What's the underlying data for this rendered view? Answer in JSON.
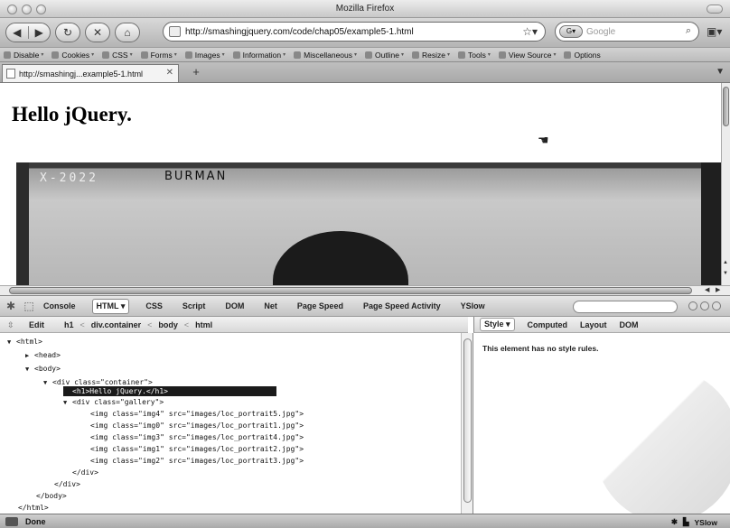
{
  "window": {
    "title": "Mozilla Firefox"
  },
  "nav": {
    "url": "http://smashingjquery.com/code/chap05/example5-1.html",
    "search_placeholder": "Google",
    "back_icon": "back-arrow-icon",
    "forward_icon": "forward-arrow-icon"
  },
  "toolbar": {
    "items": [
      "Disable",
      "Cookies",
      "CSS",
      "Forms",
      "Images",
      "Information",
      "Miscellaneous",
      "Outline",
      "Resize",
      "Tools",
      "View Source",
      "Options"
    ]
  },
  "tab": {
    "label": "http://smashingj...example5-1.html",
    "new_tab": "+"
  },
  "page": {
    "heading": "Hello jQuery.",
    "photo_caption": "X-2022",
    "photo_name": "BURMAN"
  },
  "firebug": {
    "tabs": [
      "Console",
      "HTML ▾",
      "CSS",
      "Script",
      "DOM",
      "Net",
      "Page Speed",
      "Page Speed Activity",
      "YSlow"
    ],
    "breadcrumb": {
      "edit": "Edit",
      "items": [
        "h1",
        "div.container",
        "body",
        "html"
      ]
    },
    "side_tabs": [
      "Style ▾",
      "Computed",
      "Layout",
      "DOM"
    ],
    "style_message": "This element has no style rules.",
    "html_lines": [
      "<html>",
      "<head>",
      "<body>",
      "<div class=\"container\">",
      "<h1>Hello jQuery.</h1>",
      "<div class=\"gallery\">",
      "<img class=\"img4\" src=\"images/loc_portrait5.jpg\">",
      "<img class=\"img0\" src=\"images/loc_portrait1.jpg\">",
      "<img class=\"img3\" src=\"images/loc_portrait4.jpg\">",
      "<img class=\"img1\" src=\"images/loc_portrait2.jpg\">",
      "<img class=\"img2\" src=\"images/loc_portrait3.jpg\">",
      "</div>",
      "</div>",
      "</body>",
      "</html>"
    ]
  },
  "status": {
    "text": "Done",
    "right": "YSlow"
  }
}
